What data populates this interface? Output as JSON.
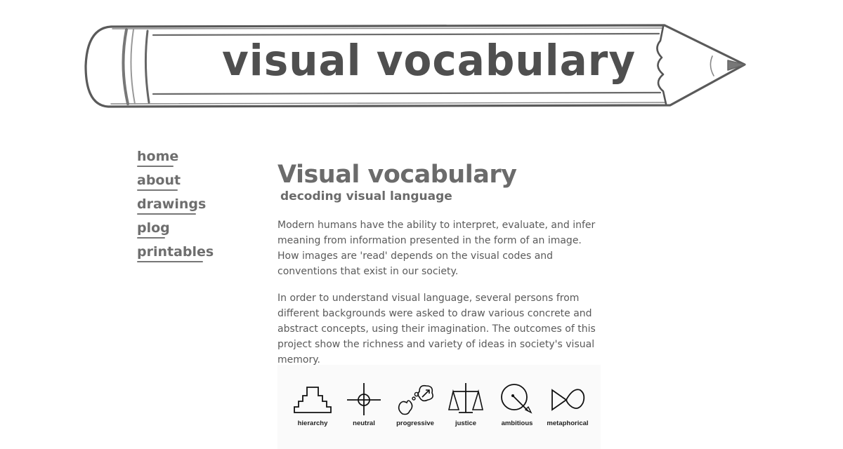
{
  "banner": {
    "title": "visual vocabulary"
  },
  "nav": {
    "items": [
      {
        "label": "home"
      },
      {
        "label": "about"
      },
      {
        "label": "drawings"
      },
      {
        "label": "plog"
      },
      {
        "label": "printables"
      }
    ]
  },
  "main": {
    "title": "Visual vocabulary",
    "subtitle": "decoding visual language",
    "paragraphs": [
      "Modern humans have the ability to interpret, evaluate, and infer meaning from information presented in the form of an image. How images are 'read' depends on the visual codes and conventions that exist in our society.",
      "In order to understand visual language, several persons from different backgrounds were asked to draw various concrete and abstract concepts, using their imagination. The outcomes of this project show the richness and variety of ideas in society's visual memory."
    ],
    "icons": [
      {
        "label": "hierarchy",
        "icon": "hierarchy-icon"
      },
      {
        "label": "neutral",
        "icon": "crosshair-icon"
      },
      {
        "label": "progressive",
        "icon": "thought-bubble-icon"
      },
      {
        "label": "justice",
        "icon": "scales-icon"
      },
      {
        "label": "ambitious",
        "icon": "target-dart-icon"
      },
      {
        "label": "metaphorical",
        "icon": "infinity-icon"
      }
    ]
  }
}
